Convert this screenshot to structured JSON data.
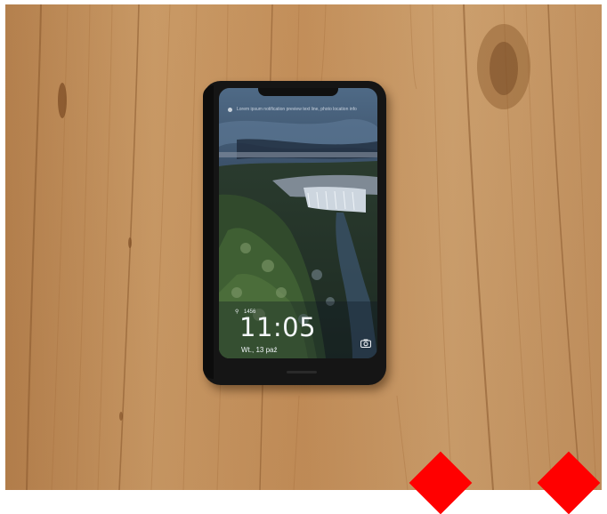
{
  "lock_screen": {
    "notification_text": "Lorem ipsum notification preview text line, photo location info",
    "steps": "1456",
    "time": "11:05",
    "date": "Wt., 13 paź"
  },
  "icons": {
    "steps": "shoe-icon",
    "camera": "camera-icon",
    "notification": "notification-dot-icon"
  },
  "colors": {
    "table": "#c9965f",
    "marker": "#ff0000",
    "phone": "#151515"
  }
}
